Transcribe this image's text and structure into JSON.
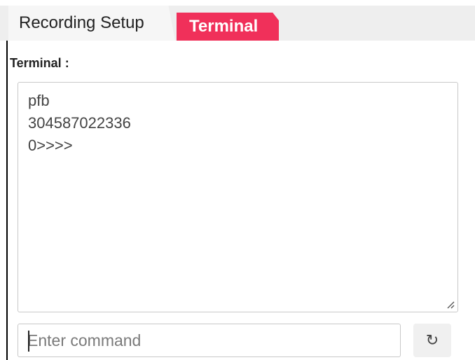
{
  "tabs": [
    {
      "label": "Recording Setup",
      "active": false
    },
    {
      "label": "Terminal",
      "active": true
    }
  ],
  "colors": {
    "active_tab": "#f0305a",
    "inactive_tab": "#f6f6f6",
    "tabbar_bg": "#eeeeee",
    "border": "#c8c8c8"
  },
  "terminal": {
    "label": "Terminal :",
    "lines": [
      "pfb",
      "304587022336",
      "0>>>>"
    ]
  },
  "command": {
    "placeholder": "Enter command",
    "value": ""
  },
  "refresh_button": {
    "icon": "refresh-icon",
    "glyph": "↻"
  }
}
